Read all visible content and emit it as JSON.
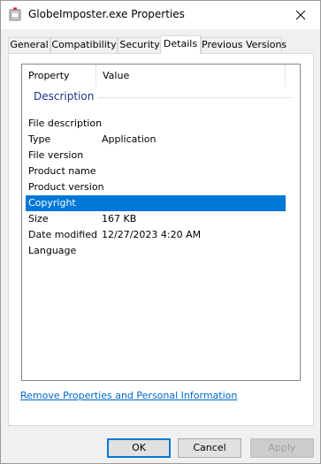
{
  "window": {
    "title": "GlobeImposter.exe Properties"
  },
  "tabs": [
    {
      "label": "General"
    },
    {
      "label": "Compatibility"
    },
    {
      "label": "Security"
    },
    {
      "label": "Details",
      "active": true
    },
    {
      "label": "Previous Versions"
    }
  ],
  "details": {
    "columns": {
      "property": "Property",
      "value": "Value"
    },
    "group": "Description",
    "rows": [
      {
        "property": "File description",
        "value": ""
      },
      {
        "property": "Type",
        "value": "Application"
      },
      {
        "property": "File version",
        "value": ""
      },
      {
        "property": "Product name",
        "value": ""
      },
      {
        "property": "Product version",
        "value": ""
      },
      {
        "property": "Copyright",
        "value": "",
        "selected": true
      },
      {
        "property": "Size",
        "value": "167 KB"
      },
      {
        "property": "Date modified",
        "value": "12/27/2023 4:20 AM"
      },
      {
        "property": "Language",
        "value": ""
      }
    ]
  },
  "link": {
    "label": "Remove Properties and Personal Information"
  },
  "buttons": {
    "ok": "OK",
    "cancel": "Cancel",
    "apply": "Apply"
  },
  "colors": {
    "selection": "#0078d7",
    "link": "#0066cc",
    "group_header": "#1e3287"
  },
  "icons": {
    "title": "application-file-icon",
    "close": "close-icon"
  }
}
